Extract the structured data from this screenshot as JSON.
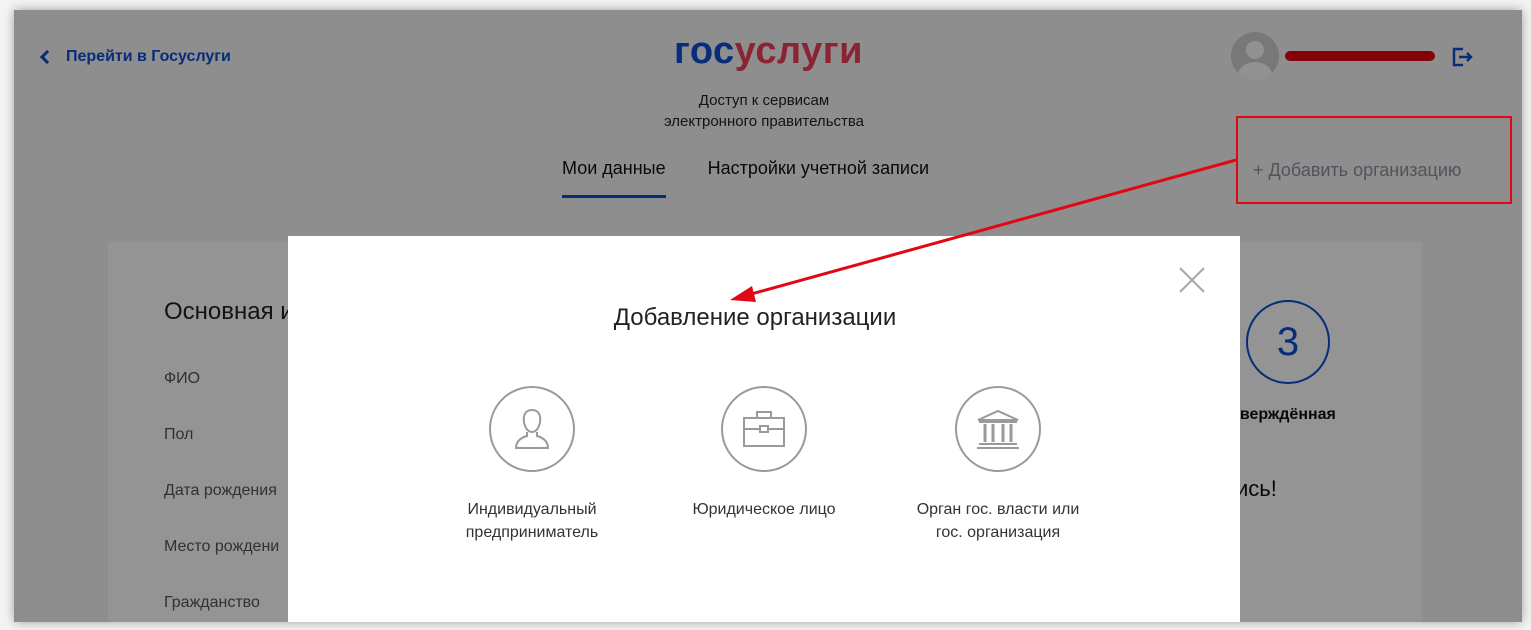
{
  "header": {
    "back_link": "Перейти в Госуслуги",
    "logo_part1": "гос",
    "logo_part2": "услуги",
    "subtitle_line1": "Доступ к сервисам",
    "subtitle_line2": "электронного правительства"
  },
  "tabs": [
    {
      "label": "Мои данные",
      "active": true
    },
    {
      "label": "Настройки учетной записи",
      "active": false
    }
  ],
  "add_org_label": "+ Добавить организацию",
  "profile": {
    "section_title": "Основная и",
    "fields": [
      "ФИО",
      "Пол",
      "Дата рождения",
      "Место рождени",
      "Гражданство"
    ],
    "account_level": "3",
    "status_text": "тверждённая",
    "greeting": "ись!"
  },
  "modal": {
    "title": "Добавление организации",
    "options": [
      {
        "label": "Индивидуальный\nпредприниматель",
        "icon": "person-icon"
      },
      {
        "label": "Юридическое лицо",
        "icon": "briefcase-icon"
      },
      {
        "label": "Орган гос. власти или\nгос. организация",
        "icon": "government-building-icon"
      }
    ]
  },
  "colors": {
    "brand_blue": "#0d4cd3",
    "brand_red": "#ee3f58",
    "annotation_red": "#e30613"
  }
}
